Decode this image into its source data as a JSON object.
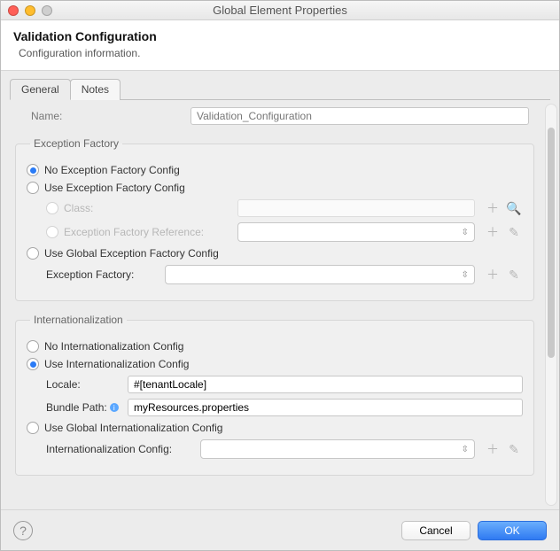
{
  "window": {
    "title": "Global Element Properties"
  },
  "header": {
    "title": "Validation Configuration",
    "subtitle": "Configuration information."
  },
  "tabs": {
    "general": "General",
    "notes": "Notes"
  },
  "name_field": {
    "label": "Name:",
    "value": "Validation_Configuration"
  },
  "exception_factory": {
    "legend": "Exception Factory",
    "no_config": "No Exception Factory Config",
    "use_config": "Use Exception Factory Config",
    "class_label": "Class:",
    "ref_label": "Exception Factory Reference:",
    "use_global": "Use Global Exception Factory Config",
    "factory_label": "Exception Factory:"
  },
  "i18n": {
    "legend": "Internationalization",
    "no_config": "No Internationalization Config",
    "use_config": "Use Internationalization Config",
    "locale_label": "Locale:",
    "locale_value": "#[tenantLocale]",
    "bundle_label": "Bundle Path:",
    "bundle_value": "myResources.properties",
    "use_global": "Use Global Internationalization Config",
    "config_label": "Internationalization Config:"
  },
  "footer": {
    "cancel": "Cancel",
    "ok": "OK"
  }
}
